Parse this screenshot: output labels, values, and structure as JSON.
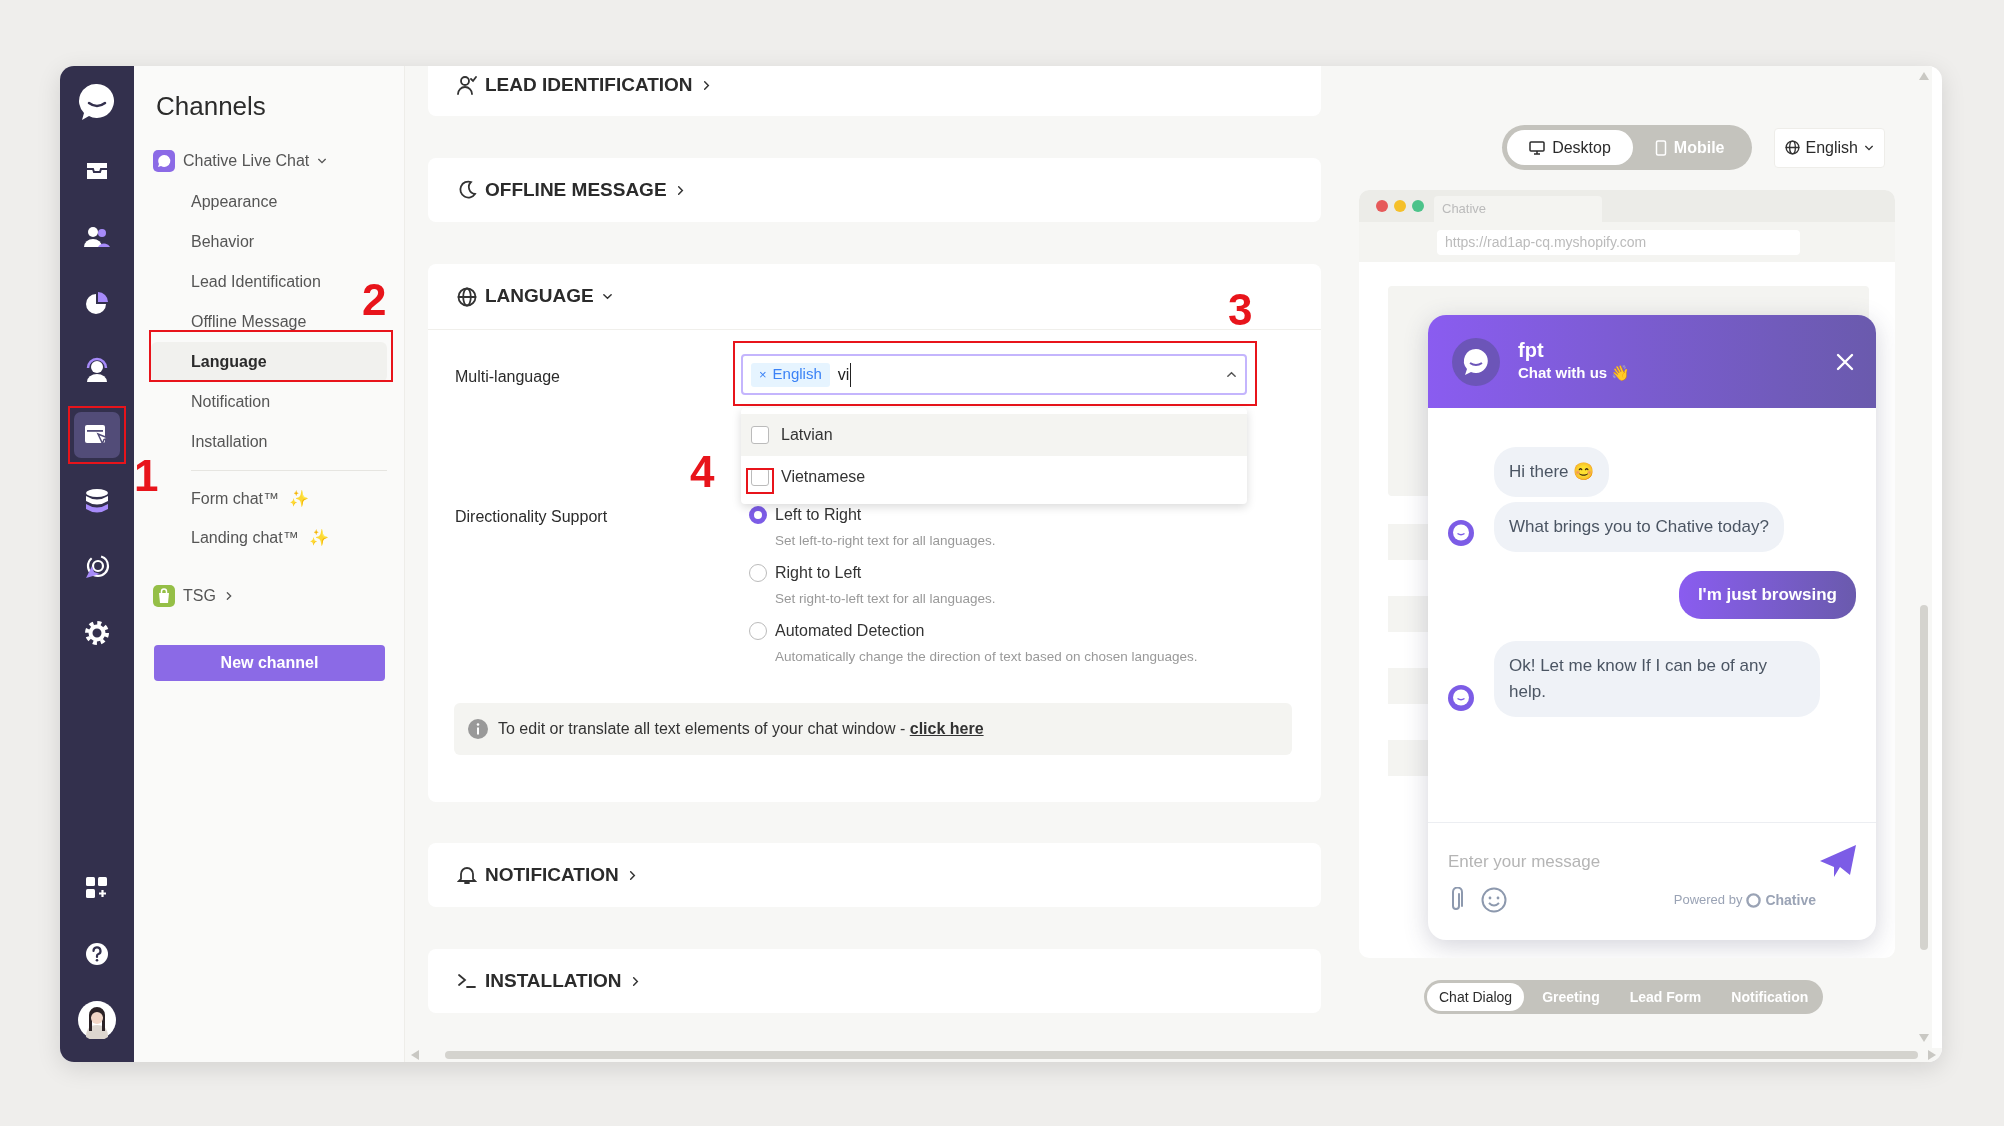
{
  "rail": {
    "items": [
      {
        "kind": "logo",
        "selected": false
      },
      {
        "kind": "inbox",
        "selected": false
      },
      {
        "kind": "contacts",
        "selected": false
      },
      {
        "kind": "reports",
        "selected": false
      },
      {
        "kind": "agent",
        "selected": false
      },
      {
        "kind": "channels",
        "selected": true
      },
      {
        "kind": "database",
        "selected": false
      },
      {
        "kind": "radar",
        "selected": false
      },
      {
        "kind": "settings",
        "selected": false
      }
    ],
    "bottom_items": [
      {
        "kind": "apps"
      },
      {
        "kind": "help"
      },
      {
        "kind": "avatar"
      }
    ]
  },
  "channels": {
    "title": "Channels",
    "groups": [
      {
        "name": "Chative Live Chat",
        "kind": "livechat",
        "expanded": true,
        "items": [
          {
            "label": "Appearance",
            "selected": false
          },
          {
            "label": "Behavior",
            "selected": false
          },
          {
            "label": "Lead Identification",
            "selected": false
          },
          {
            "label": "Offline Message",
            "selected": false
          },
          {
            "label": "Language",
            "selected": true
          },
          {
            "label": "Notification",
            "selected": false
          },
          {
            "label": "Installation",
            "selected": false
          }
        ],
        "extras": [
          {
            "label": "Form chat™",
            "badge": "✨"
          },
          {
            "label": "Landing chat™",
            "badge": "✨"
          }
        ]
      },
      {
        "name": "TSG",
        "kind": "shop",
        "expanded": false
      }
    ],
    "new_button": "New channel"
  },
  "sections": [
    {
      "kind": "lead",
      "title": "LEAD IDENTIFICATION",
      "expanded": false
    },
    {
      "kind": "offline",
      "title": "OFFLINE MESSAGE",
      "expanded": false
    },
    {
      "kind": "language",
      "title": "LANGUAGE",
      "expanded": true
    },
    {
      "kind": "notification",
      "title": "NOTIFICATION",
      "expanded": false
    },
    {
      "kind": "installation",
      "title": "INSTALLATION",
      "expanded": false
    }
  ],
  "language": {
    "multi_language": {
      "label": "Multi-language",
      "tags": [
        {
          "remove": "×",
          "label": "English"
        }
      ],
      "value": "vi",
      "open": true,
      "options": [
        {
          "label": "Latvian",
          "checked": false,
          "highlighted": true
        },
        {
          "label": "Vietnamese",
          "checked": false,
          "highlighted": false
        }
      ]
    },
    "directionality": {
      "label": "Directionality Support",
      "options": [
        {
          "label": "Left to Right",
          "description": "Set left-to-right text for all languages.",
          "selected": true
        },
        {
          "label": "Right to Left",
          "description": "Set right-to-left text for all languages.",
          "selected": false
        },
        {
          "label": "Automated Detection",
          "description": "Automatically change the direction of text based on chosen languages.",
          "selected": false
        }
      ]
    },
    "info": {
      "text": "To edit or translate all text elements of your chat window - ",
      "link": "click here"
    }
  },
  "preview": {
    "view_modes": [
      {
        "kind": "desktop",
        "label": "Desktop",
        "selected": true
      },
      {
        "kind": "mobile",
        "label": "Mobile",
        "selected": false
      }
    ],
    "language": "English",
    "browser": {
      "tab": "Chative",
      "url": "https://rad1ap-cq.myshopify.com"
    },
    "widget": {
      "name": "fpt",
      "subtitle": "Chat with us 👋",
      "messages": [
        {
          "kind": "bot",
          "text": "Hi there 😊"
        },
        {
          "kind": "bot",
          "text": "What brings you to Chative today?"
        },
        {
          "kind": "user",
          "text": "I'm just browsing"
        },
        {
          "kind": "bot",
          "text": "Ok! Let me know If I can be of any help."
        }
      ],
      "placeholder": "Enter your message",
      "powered_by": "Powered by",
      "brand": "Chative"
    },
    "tabs": [
      {
        "label": "Chat Dialog",
        "selected": true
      },
      {
        "label": "Greeting",
        "selected": false
      },
      {
        "label": "Lead Form",
        "selected": false
      },
      {
        "label": "Notification",
        "selected": false
      }
    ]
  },
  "annotations": [
    {
      "label": "1"
    },
    {
      "label": "2"
    },
    {
      "label": "3"
    },
    {
      "label": "4"
    }
  ]
}
